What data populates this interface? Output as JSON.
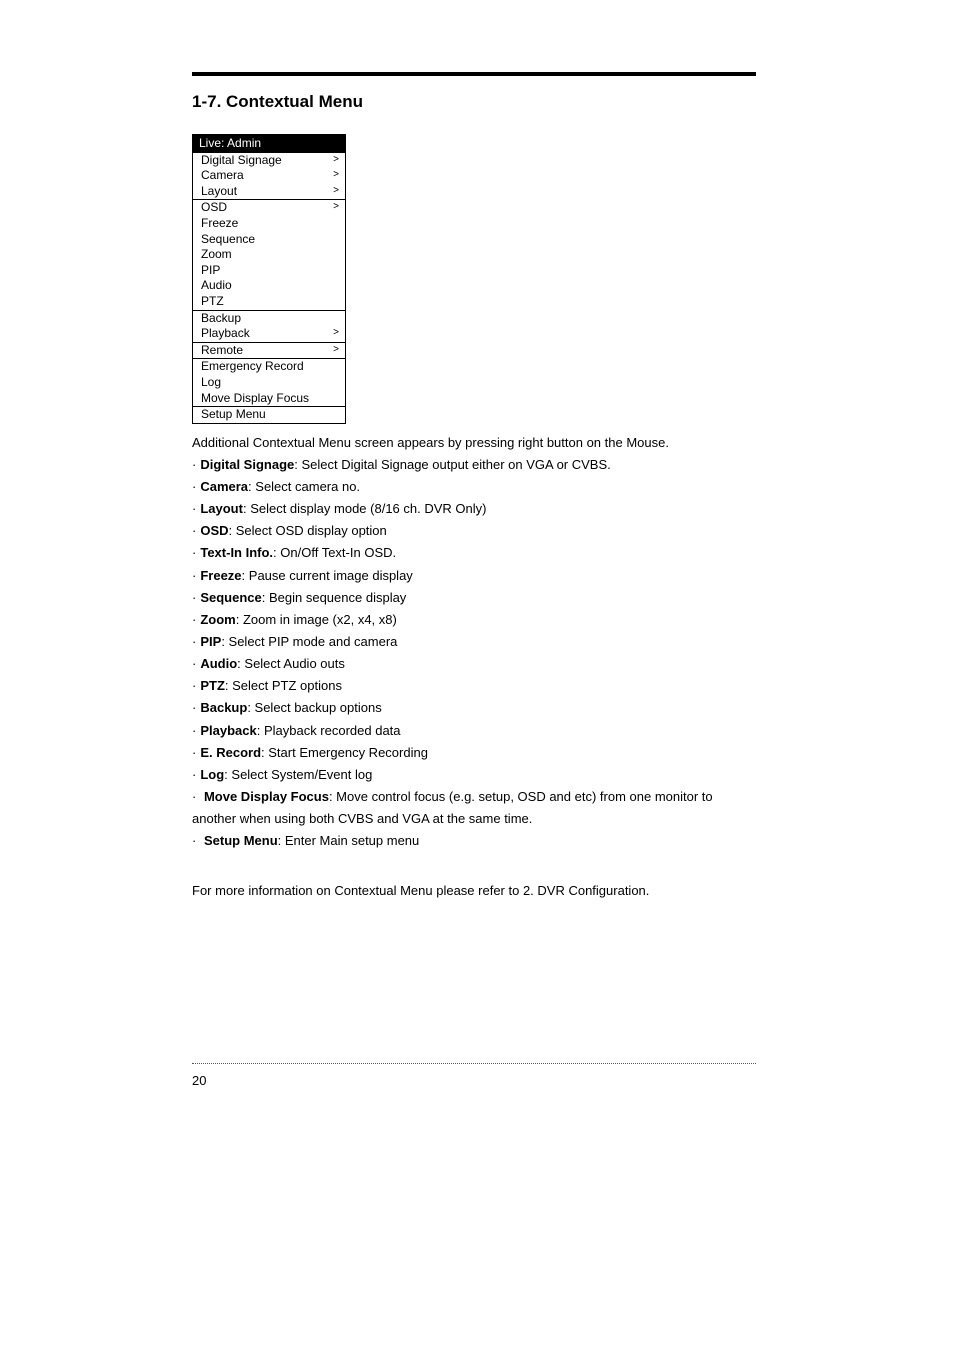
{
  "heading": "1-7. Contextual Menu",
  "menu": {
    "header": "Live: Admin",
    "items": [
      {
        "label": "Digital Signage",
        "arrow": true,
        "sep": false
      },
      {
        "label": "Camera",
        "arrow": true,
        "sep": false
      },
      {
        "label": "Layout",
        "arrow": true,
        "sep": true
      },
      {
        "label": "OSD",
        "arrow": true,
        "sep": false
      },
      {
        "label": "Freeze",
        "arrow": false,
        "sep": false
      },
      {
        "label": "Sequence",
        "arrow": false,
        "sep": false
      },
      {
        "label": "Zoom",
        "arrow": false,
        "sep": false
      },
      {
        "label": "PIP",
        "arrow": false,
        "sep": false
      },
      {
        "label": "Audio",
        "arrow": false,
        "sep": false
      },
      {
        "label": "PTZ",
        "arrow": false,
        "sep": true
      },
      {
        "label": "Backup",
        "arrow": false,
        "sep": false
      },
      {
        "label": "Playback",
        "arrow": true,
        "sep": true
      },
      {
        "label": "Remote",
        "arrow": true,
        "sep": true
      },
      {
        "label": "Emergency Record",
        "arrow": false,
        "sep": false
      },
      {
        "label": "Log",
        "arrow": false,
        "sep": false
      },
      {
        "label": "Move Display Focus",
        "arrow": false,
        "sep": true
      },
      {
        "label": "Setup Menu",
        "arrow": false,
        "sep": false
      }
    ]
  },
  "intro": "Additional Contextual Menu screen appears by pressing right button on the Mouse.",
  "bullet": "·",
  "arrowGlyph": ">",
  "descriptions": [
    {
      "term": "Digital Signage",
      "text": ": Select Digital Signage output either on VGA or CVBS."
    },
    {
      "term": "Camera",
      "text": ": Select camera no."
    },
    {
      "term": "Layout",
      "text": ": Select display mode (8/16 ch. DVR Only)"
    },
    {
      "term": "OSD",
      "text": ": Select OSD display option"
    },
    {
      "term": "Text-In Info.",
      "text": ": On/Off Text-In OSD."
    },
    {
      "term": "Freeze",
      "text": ": Pause current image display"
    },
    {
      "term": "Sequence",
      "text": ": Begin sequence display"
    },
    {
      "term": "Zoom",
      "text": ": Zoom in image (x2, x4, x8)"
    },
    {
      "term": "PIP",
      "text": ": Select PIP mode and camera"
    },
    {
      "term": "Audio",
      "text": ": Select Audio outs"
    },
    {
      "term": "PTZ",
      "text": ": Select PTZ options"
    },
    {
      "term": "Backup",
      "text": ": Select backup options"
    },
    {
      "term": "Playback",
      "text": ": Playback recorded data"
    },
    {
      "term": "E. Record",
      "text": ": Start Emergency Recording"
    },
    {
      "term": "Log",
      "text": ": Select System/Event log"
    }
  ],
  "mdf": {
    "term": "Move Display Focus",
    "tail": ": Move control focus (e.g. setup, OSD and etc) from one monitor to",
    "cont": "another when using both CVBS and VGA at the same time."
  },
  "setup": {
    "term": "Setup Menu",
    "text": ": Enter Main setup menu"
  },
  "closing": "For more information on Contextual Menu please refer to 2. DVR Configuration.",
  "pageNumber": "20"
}
